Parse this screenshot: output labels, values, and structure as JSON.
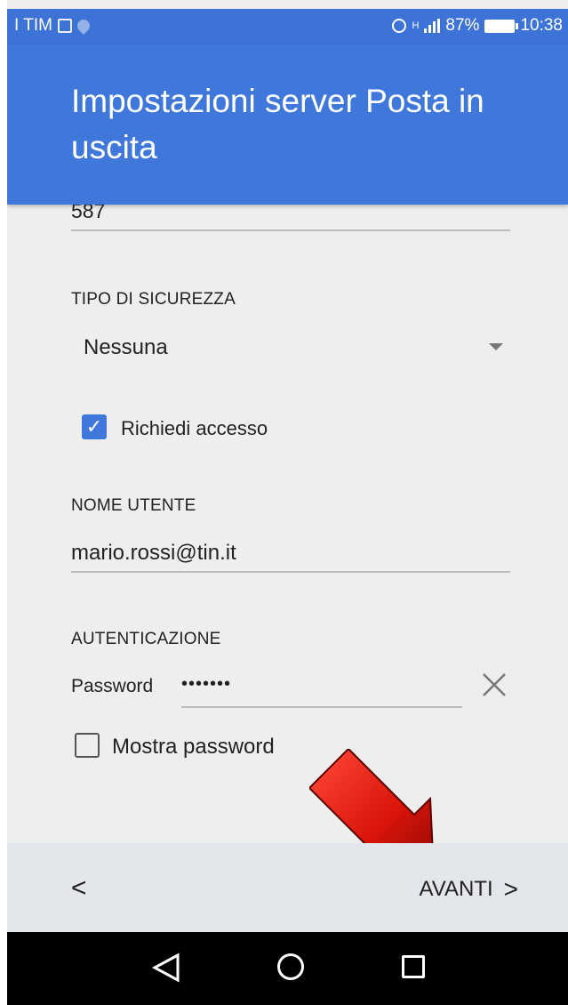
{
  "status_bar": {
    "carrier": "I TIM",
    "network": "H",
    "battery": "87%",
    "time": "10:38"
  },
  "app_bar": {
    "title": "Impostazioni server Posta in uscita"
  },
  "form": {
    "port_value": "587",
    "security_label": "TIPO DI SICUREZZA",
    "security_value": "Nessuna",
    "require_signin_label": "Richiedi accesso",
    "require_signin_checked": true,
    "username_label": "NOME UTENTE",
    "username_value": "mario.rossi@tin.it",
    "auth_label": "AUTENTICAZIONE",
    "password_label": "Password",
    "password_mask": "•••••••",
    "show_password_label": "Mostra password",
    "show_password_checked": false
  },
  "actions": {
    "back_label": "<",
    "next_label": "AVANTI",
    "next_chevron": ">"
  },
  "colors": {
    "accent": "#3f78da",
    "arrow": "#d9140a"
  }
}
